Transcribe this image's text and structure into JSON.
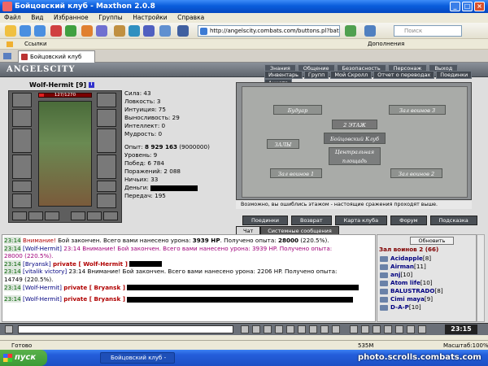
{
  "window": {
    "title": "Бойцовский клуб - Maxthon 2.0.8",
    "min": "_",
    "max": "□",
    "close": "×"
  },
  "menu": [
    "Файл",
    "Вид",
    "Избранное",
    "Группы",
    "Настройки",
    "Справка"
  ],
  "toolbar": {
    "address": "http://angelscity.combats.com/buttons.pl?battle=0.91",
    "search_placeholder": "Поиск",
    "extras": "Дополнения"
  },
  "links": {
    "label": "Ссылки"
  },
  "tab": {
    "label": "Бойцовский клуб"
  },
  "game": {
    "logo": "ANGELSCITY",
    "nav_top": [
      "Знания",
      "Общение",
      "Безопасность",
      "Персонаж",
      "Выход"
    ],
    "nav_bottom": [
      "Инвентарь",
      "Групп",
      "Мой Скролл",
      "Отчет о переводах",
      "Поединки",
      "Анкета"
    ],
    "character": {
      "name": "Wolf-Hermit",
      "level": "[9]",
      "hp": "127/1270",
      "hp_fraction": 0.1
    },
    "stats": {
      "str": "Сила: 43",
      "agi": "Ловкость: 3",
      "int": "Интуиция: 75",
      "end": "Выносливость: 29",
      "intel": "Интеллект: 0",
      "wis": "Мудрость: 0",
      "exp_label": "Опыт:",
      "exp_value": "8 929 163",
      "exp_next": "(9000000)",
      "level": "Уровень: 9",
      "wins": "Побед: 6 784",
      "losses": "Поражений: 2 088",
      "draws": "Ничьих: 33",
      "money": "Деньги:",
      "transfer": "Передач: 195"
    },
    "map": {
      "caption": "Возможно, вы ошиблись этажом - настоящие сражения проходят выше.",
      "buildings": [
        "Будуар",
        "Зал воинов 3",
        "2 ЭТАЖ",
        "Бойцовский Клуб",
        "ЗАЛЫ",
        "Центральная площадь",
        "Зал воинов 1",
        "Зал воинов 2"
      ]
    },
    "buttons": [
      "Поединки",
      "Возврат",
      "Карта клуба",
      "Форум",
      "Подсказка"
    ],
    "chat_tabs": [
      "Чат",
      "Системные сообщения"
    ],
    "chat": [
      {
        "ts": "23:14",
        "pre": "Внимание!",
        "text": " Бой закончен. Всего вами нанесено урона: ",
        "b1": "3939 HP",
        "text2": ". Получено опыта: ",
        "b2": "28000",
        "text3": " (220.5%)."
      },
      {
        "ts": "23:14",
        "nick": "[Wolf-Hermit]",
        "text": " 23:14 Внимание! Бой закончен. Всего вами нанесено урона: 3939 HP. Получено опыта:"
      },
      {
        "cont": "28000 (220.5%)."
      },
      {
        "ts": "23:14",
        "nick": "[Bryansk]",
        "priv": "private [ Wolf-Hermit ]"
      },
      {
        "ts": "23:14",
        "nick": "[vitalik victory]",
        "text": " 23:14 Внимание! Бой закончен. Всего вами нанесено урона: 2206 HP. Получено опыта:"
      },
      {
        "cont": "14749 (220.5%)."
      },
      {
        "ts": "23:14",
        "nick": "[Wolf-Hermit]",
        "priv": "private [ Bryansk ]"
      },
      {
        "ts": "23:14",
        "nick": "[Wolf-Hermit]",
        "priv": "private [ Bryansk ]"
      }
    ],
    "right": {
      "refresh": "Обновить",
      "room": "Зал воинов 2 (66)",
      "players": [
        {
          "name": "Acidapple",
          "lvl": "[8]"
        },
        {
          "name": "Airman",
          "lvl": "[11]"
        },
        {
          "name": "anj",
          "lvl": "[10]"
        },
        {
          "name": "Atom life",
          "lvl": "[10]"
        },
        {
          "name": "BALUSTRADO",
          "lvl": "[8]"
        },
        {
          "name": "Cimi maya",
          "lvl": "[9]"
        },
        {
          "name": "D-A-P",
          "lvl": "[10]"
        }
      ]
    },
    "clock": "23:15"
  },
  "status": {
    "left": "Готово",
    "mem": "535M",
    "zoom": "Масштаб:100%"
  },
  "taskbar": {
    "start": "пуск",
    "item": "Бойцовский клуб - M..."
  },
  "watermark": "photo.scrolls.combats.com"
}
